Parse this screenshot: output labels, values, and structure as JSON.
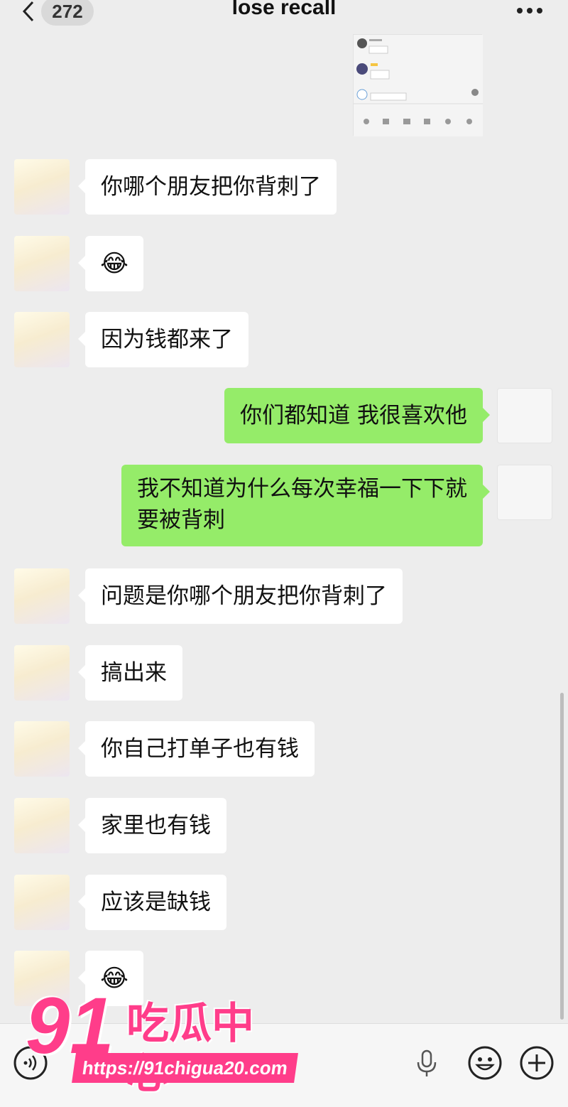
{
  "header": {
    "unread_count": "272",
    "title": "lose recall",
    "icons": [
      "back-chevron-icon",
      "more-dots-icon"
    ]
  },
  "messages": [
    {
      "side": "left",
      "text": "你哪个朋友把你背刺了"
    },
    {
      "side": "left",
      "text": "😂"
    },
    {
      "side": "left",
      "text": "因为钱都来了"
    },
    {
      "side": "right",
      "text": "你们都知道 我很喜欢他"
    },
    {
      "side": "right",
      "lines": [
        "我不知道为什么每次幸福一下下就",
        "要被背刺"
      ]
    },
    {
      "side": "left",
      "text": "问题是你哪个朋友把你背刺了"
    },
    {
      "side": "left",
      "text": "搞出来"
    },
    {
      "side": "left",
      "text": "你自己打单子也有钱"
    },
    {
      "side": "left",
      "text": "家里也有钱"
    },
    {
      "side": "left",
      "text": "应该是缺钱"
    },
    {
      "side": "left",
      "text": "😂"
    }
  ],
  "input_bar": {
    "icons": [
      "voice-toggle-icon",
      "microphone-icon",
      "emoji-icon",
      "plus-icon"
    ]
  },
  "watermark": {
    "logo_number": "91",
    "logo_name": "吃瓜中心",
    "url": "https://91chigua20.com"
  },
  "colors": {
    "background": "#ededed",
    "outgoing_bubble": "#95ec69",
    "incoming_bubble": "#ffffff",
    "watermark": "#ff3d8a"
  }
}
